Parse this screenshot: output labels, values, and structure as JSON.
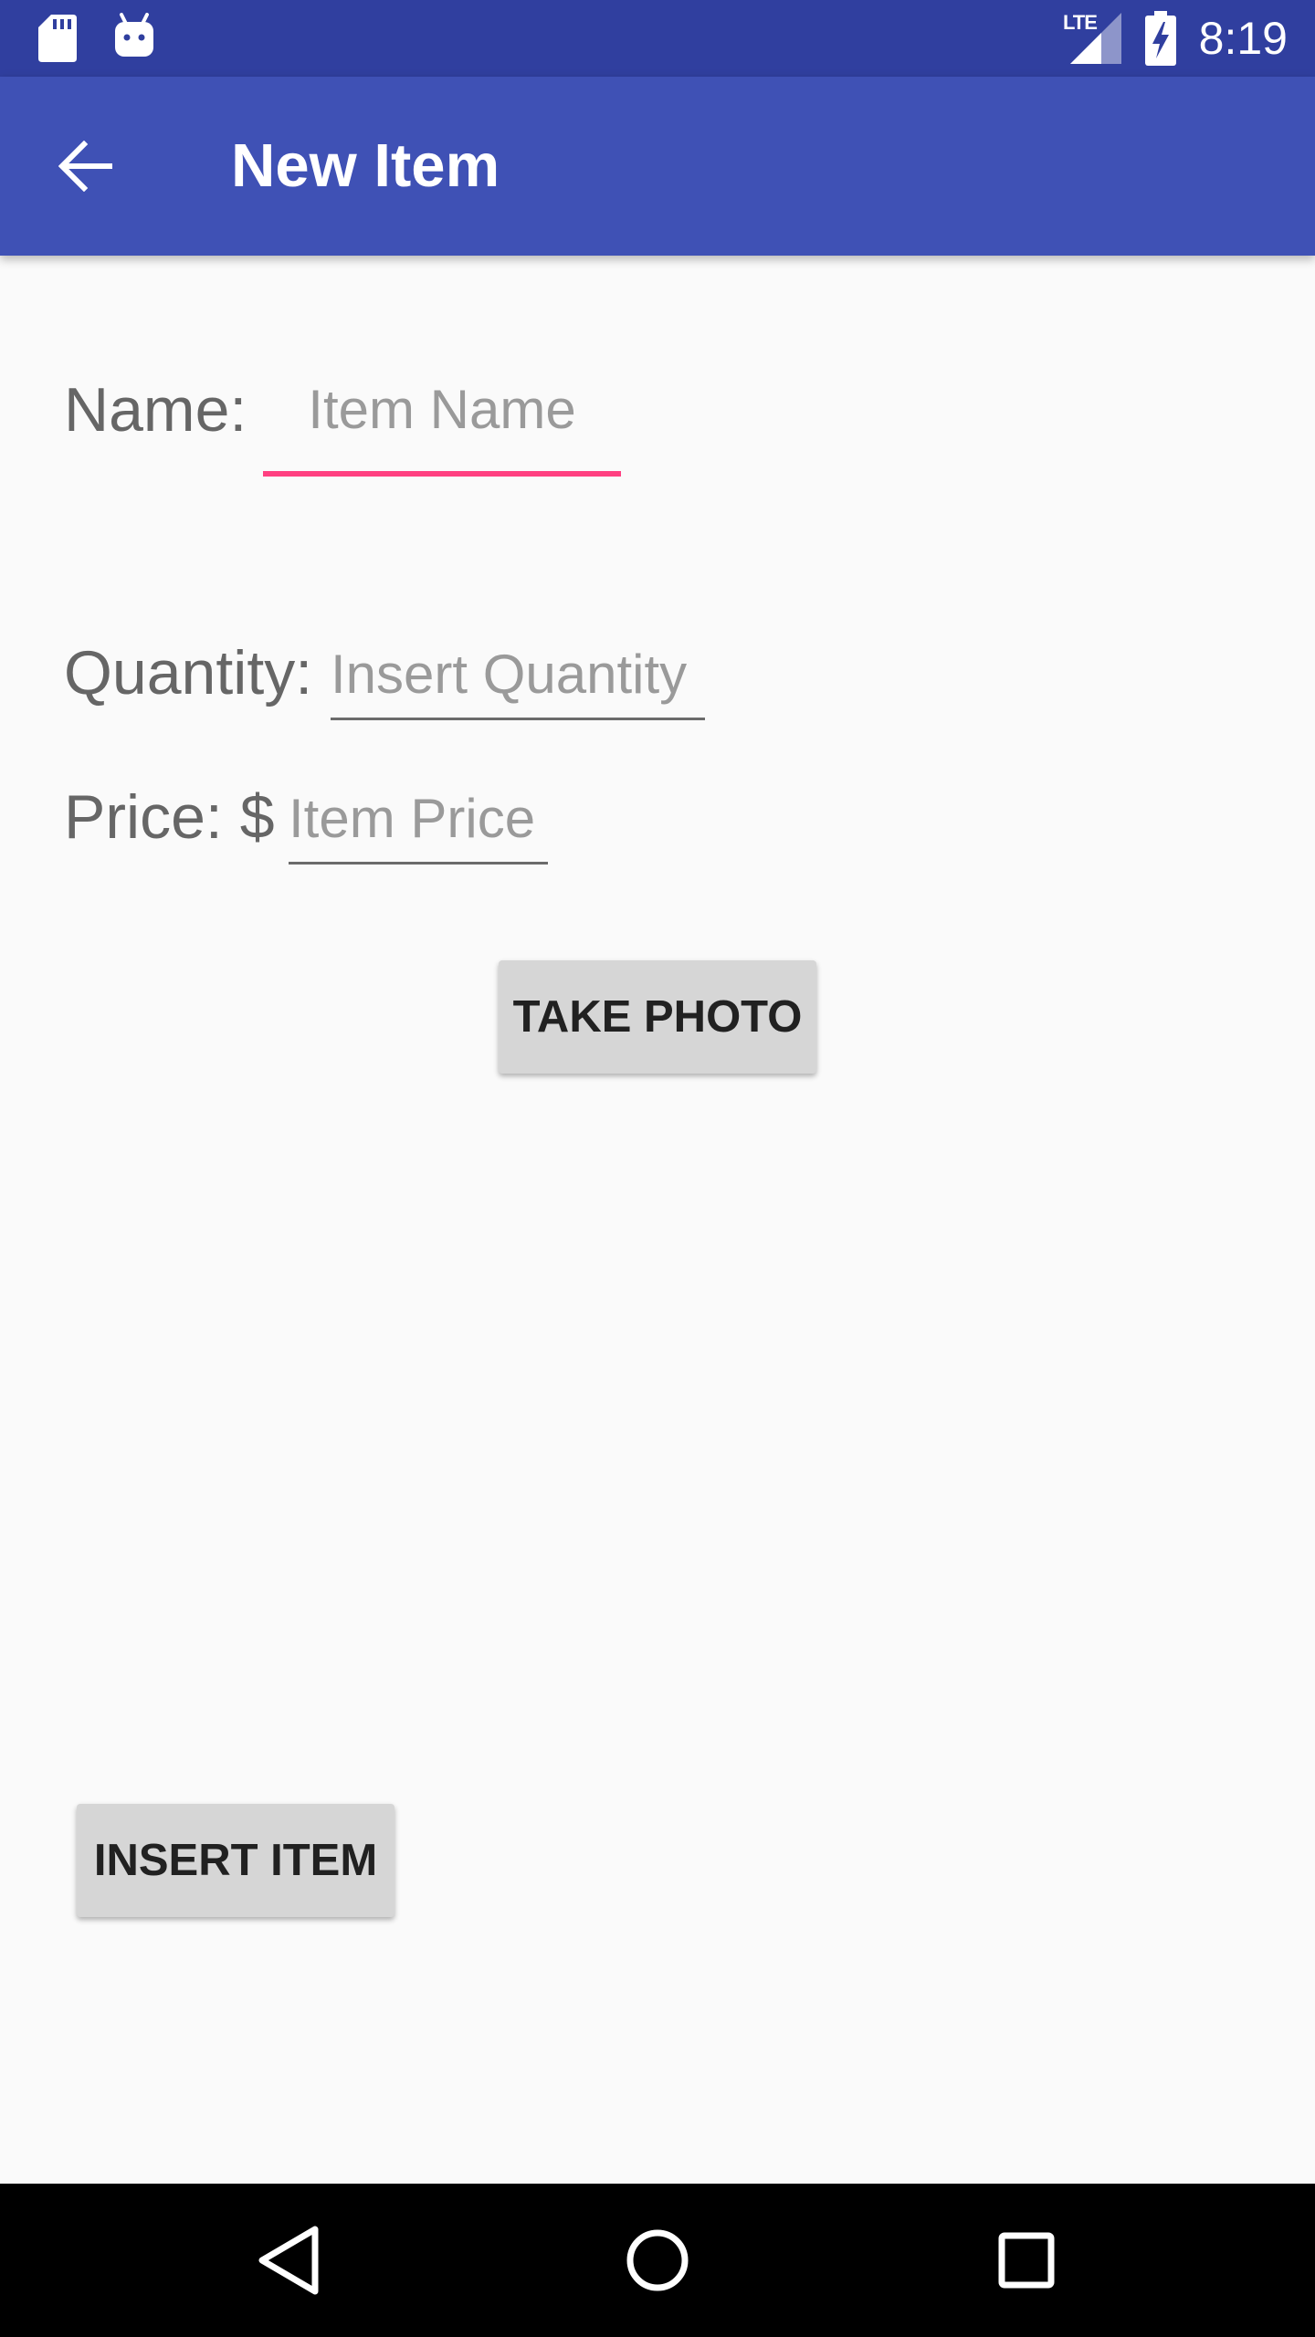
{
  "status_bar": {
    "time": "8:19",
    "network_label": "LTE",
    "icons": [
      "sd-card-icon",
      "android-icon",
      "lte-signal-icon",
      "battery-charging-icon"
    ],
    "background_color": "#303f9f"
  },
  "app_bar": {
    "title": "New Item",
    "back_icon": "arrow-back-icon",
    "background_color": "#3f51b5"
  },
  "form": {
    "name": {
      "label": "Name:",
      "placeholder": "Item Name",
      "value": "",
      "focused": true
    },
    "quantity": {
      "label": "Quantity:",
      "placeholder": "Insert Quantity",
      "value": ""
    },
    "price": {
      "label": "Price: $",
      "placeholder": "Item Price",
      "value": ""
    }
  },
  "buttons": {
    "take_photo": "TAKE PHOTO",
    "insert_item": "INSERT ITEM"
  },
  "nav_bar": {
    "icons": [
      "back-triangle-icon",
      "home-circle-icon",
      "recents-square-icon"
    ]
  },
  "colors": {
    "accent": "#ff4081",
    "primary": "#3f51b5",
    "primary_dark": "#303f9f"
  }
}
